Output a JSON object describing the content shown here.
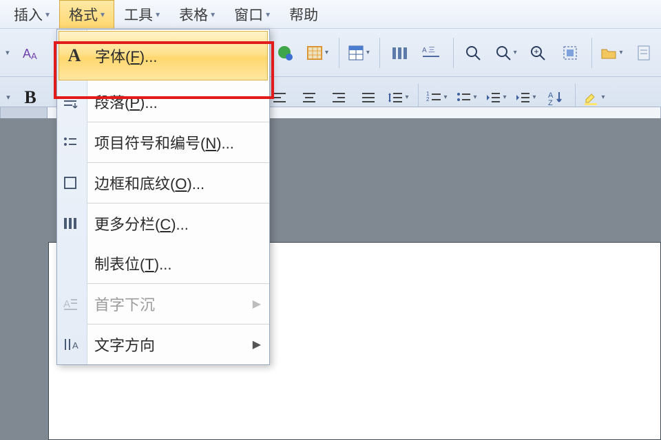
{
  "menubar": {
    "items": [
      {
        "label": "插入",
        "active": false
      },
      {
        "label": "格式",
        "active": true
      },
      {
        "label": "工具",
        "active": false
      },
      {
        "label": "表格",
        "active": false
      },
      {
        "label": "窗口",
        "active": false
      },
      {
        "label": "帮助",
        "active": false
      }
    ]
  },
  "dropdown": {
    "items": [
      {
        "label": "字体",
        "accel": "F",
        "icon": "A",
        "highlight": true
      },
      {
        "label": "段落",
        "accel": "P",
        "icon": "para"
      },
      {
        "label": "项目符号和编号",
        "accel": "N",
        "icon": "bullets"
      },
      {
        "label": "边框和底纹",
        "accel": "O",
        "icon": "border"
      },
      {
        "label": "更多分栏",
        "accel": "C",
        "icon": "columns"
      },
      {
        "label": "制表位",
        "accel": "T"
      },
      {
        "label": "首字下沉",
        "submenu": true,
        "disabled": true,
        "icon": "dropcap"
      },
      {
        "label": "文字方向",
        "submenu": true,
        "icon": "direction"
      }
    ]
  },
  "toolbar": {
    "row1_icons": [
      "aa-replace",
      "find",
      "link",
      "cells-shade",
      "table",
      "columns-lg",
      "abc-strike",
      "zoom",
      "zoom-target",
      "zoom100",
      "select-all",
      "folder",
      "forms"
    ],
    "row2_icons": [
      "bold",
      "align-left",
      "align-center",
      "align-right",
      "align-justify",
      "linespace",
      "num-list",
      "bul-list",
      "a-sup",
      "a-sub",
      "sort-az",
      "highlight"
    ],
    "bold_label": "B"
  }
}
